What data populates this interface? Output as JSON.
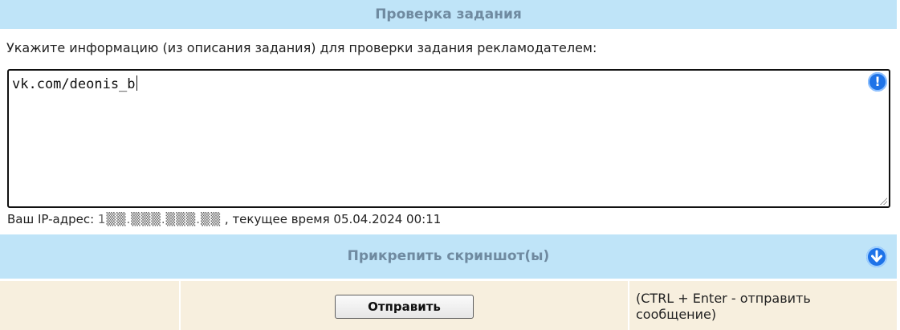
{
  "header": {
    "title": "Проверка задания"
  },
  "instruction": {
    "text": "Укажите информацию (из описания задания) для проверки задания рекламодателем:"
  },
  "task_input": {
    "value": "vk.com/deonis_b",
    "alert_icon_glyph": "!"
  },
  "ip_info": {
    "prefix": "Ваш IP-адрес: ",
    "ip_masked": "1▒▒.▒▒▒.▒▒▒.▒▒",
    "time_label": " , текущее время ",
    "datetime": "05.04.2024 00:11"
  },
  "attach": {
    "title": "Прикрепить скриншот(ы)"
  },
  "footer": {
    "send_label": "Отправить",
    "hint": "(CTRL + Enter - отправить сообщение)"
  },
  "colors": {
    "bar_bg": "#bfe4f8",
    "bar_text": "#6f8aa0",
    "footer_bg": "#f7efde",
    "icon_blue": "#1e73e8"
  }
}
